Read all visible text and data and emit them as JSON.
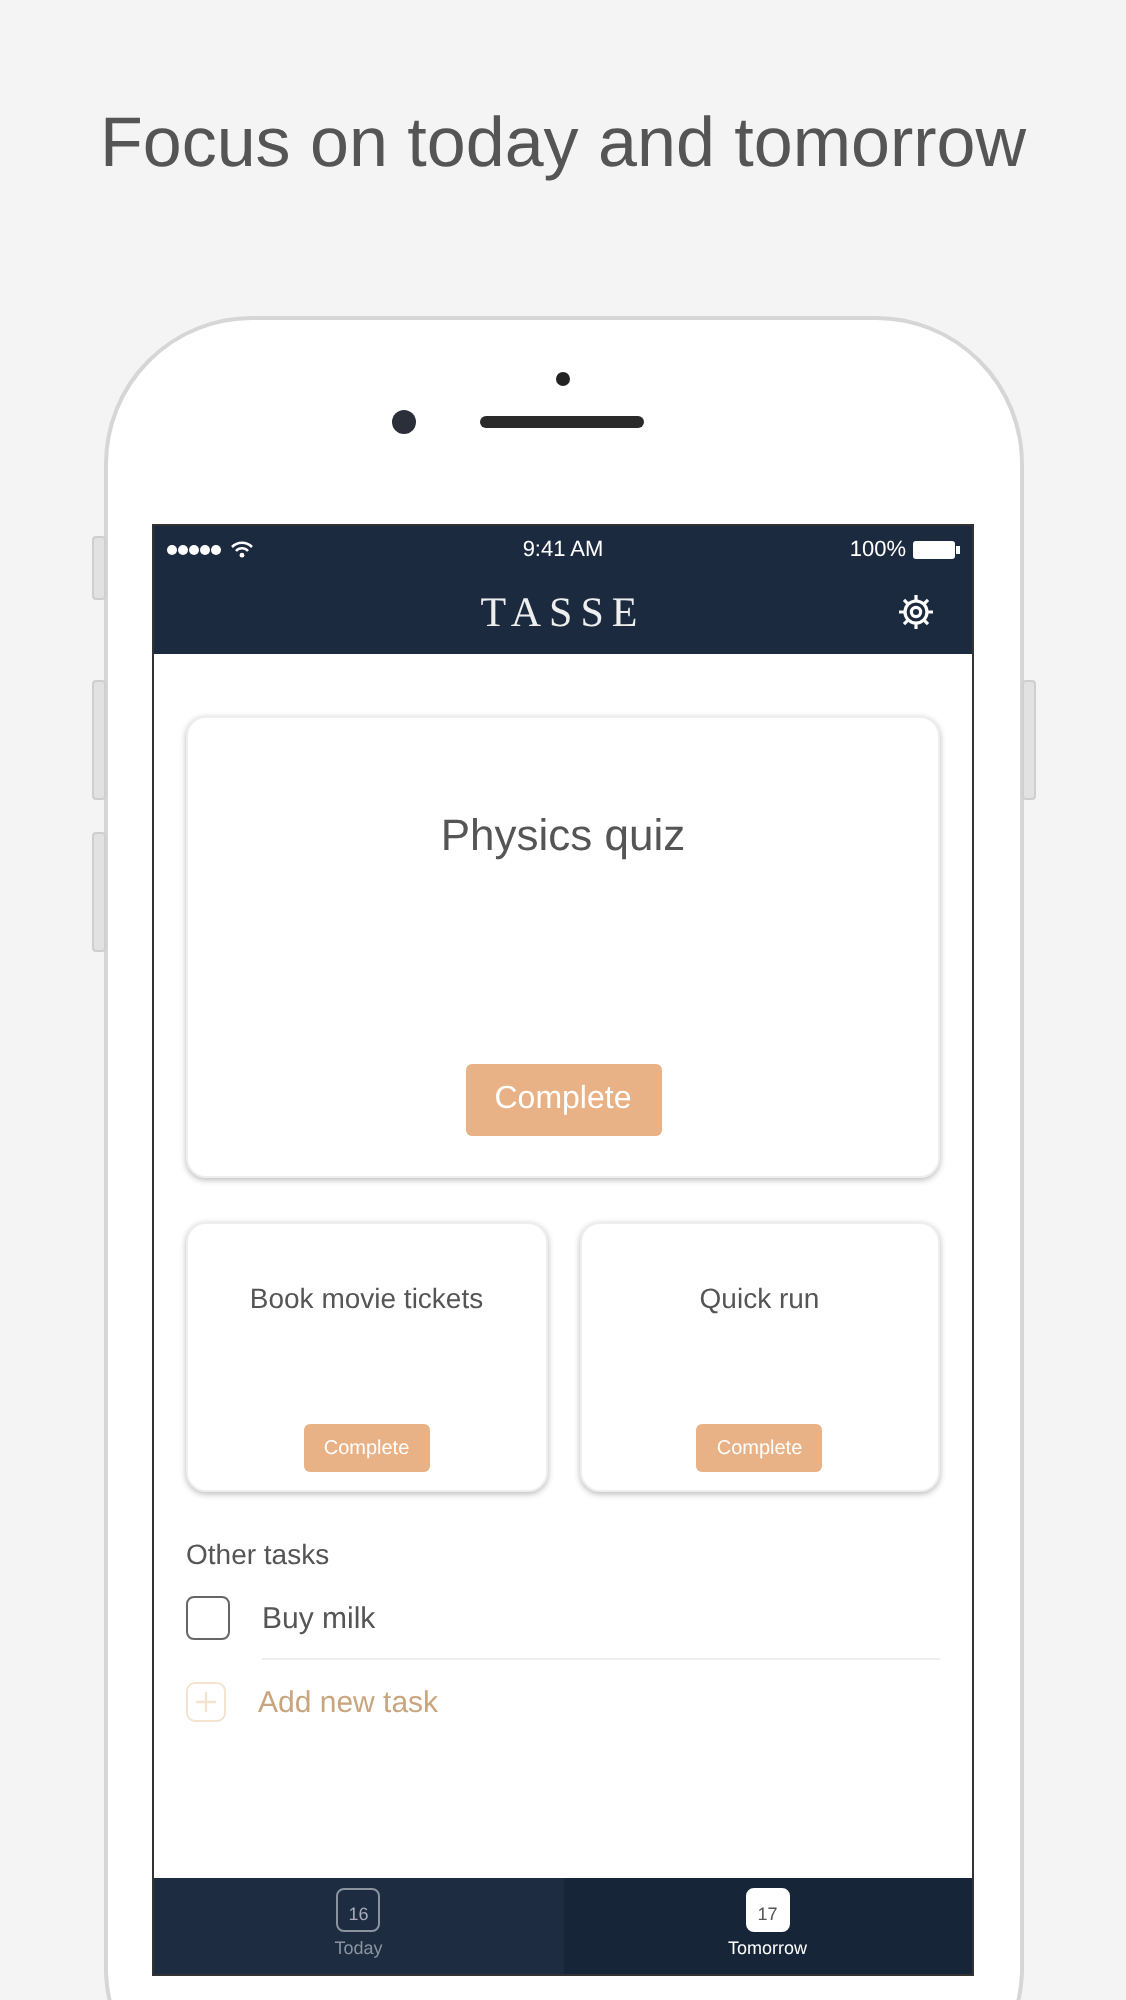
{
  "headline": "Focus on today and tomorrow",
  "status_bar": {
    "time": "9:41 AM",
    "battery": "100%"
  },
  "nav_bar": {
    "title": "TASSE"
  },
  "focus_tasks": [
    {
      "kind": "large",
      "title": "Physics quiz",
      "button": "Complete"
    },
    {
      "kind": "small",
      "title": "Book movie tickets",
      "button": "Complete"
    },
    {
      "kind": "small",
      "title": "Quick run",
      "button": "Complete"
    }
  ],
  "other_tasks": {
    "heading": "Other tasks",
    "items": [
      {
        "label": "Buy milk",
        "checked": false
      }
    ],
    "add_placeholder": "Add new task"
  },
  "tabs": [
    {
      "label": "Today",
      "date": "16",
      "selected": false
    },
    {
      "label": "Tomorrow",
      "date": "17",
      "selected": true
    }
  ]
}
